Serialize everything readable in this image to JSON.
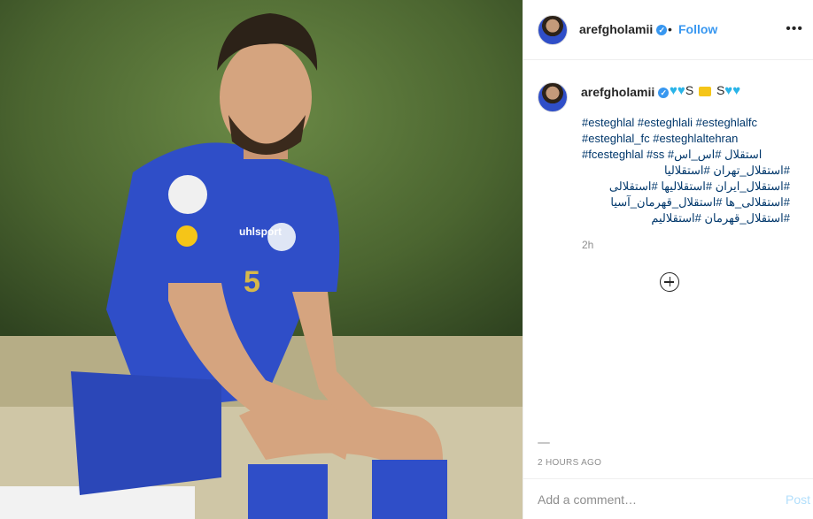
{
  "post": {
    "image_alt": "Player in blue Esteghlal kit seated outdoors",
    "kit_brand": "uhlsport",
    "kit_number": "5"
  },
  "header": {
    "username": "arefgholamii",
    "verified_icon": "verified-badge-icon",
    "dot": "•",
    "follow_label": "Follow",
    "more_icon": "more-options-icon",
    "more_glyph": "•••"
  },
  "caption": {
    "username": "arefgholamii",
    "emoji_text_1": "S",
    "emoji_text_2": "S",
    "tags_lines": [
      "#esteghlal #esteghlali #esteghlalfc",
      "#esteghlal_fc #esteghlaltehran",
      "#fcesteghlal #ss #استقلال #اس_اس",
      "#استقلال_تهران #استقلالیا",
      "#استقلال_ایران #استقلالیها #استقلالی",
      "#استقلالی_ها #استقلال_قهرمان_آسیا",
      "#استقلال_قهرمان #استقلالیم"
    ],
    "ago": "2h"
  },
  "actions": {
    "load_more_icon": "add-circle-icon"
  },
  "timestamp": "2 HOURS AGO",
  "comment": {
    "placeholder": "Add a comment…",
    "post_label": "Post"
  },
  "colors": {
    "link": "#00376b",
    "follow": "#3897f0",
    "post_disabled": "#b2dffc",
    "kit_blue": "#2f4ec8"
  }
}
